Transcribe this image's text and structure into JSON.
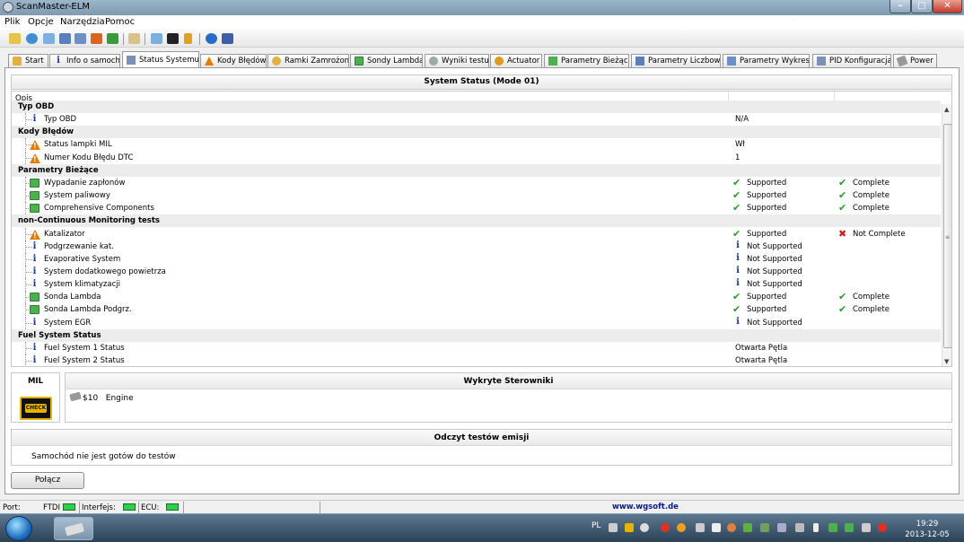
{
  "window": {
    "title": "ScanMaster-ELM"
  },
  "menu": [
    "Plik",
    "Opcje",
    "Narzędzia",
    "Pomoc"
  ],
  "tabs": [
    "Start",
    "Info o samoch.",
    "Status Systemu",
    "Kody Błędów",
    "Ramki Zamrożone",
    "Sondy Lambda",
    "Wyniki testu",
    "Actuator",
    "Parametry Bieżące",
    "Parametry Liczbowe",
    "Parametry Wykresy",
    "PID Konfiguracja",
    "Power"
  ],
  "active_tab": "Status Systemu",
  "system_status": {
    "title": "System Status (Mode 01)",
    "column_header": "Opis",
    "groups": [
      {
        "label": "Typ OBD",
        "rows": [
          {
            "icon": "info-icon",
            "label": "Typ OBD",
            "value": "N/A"
          }
        ]
      },
      {
        "label": "Kody Błędów",
        "rows": [
          {
            "icon": "warning-icon",
            "label": "Status lampki MIL",
            "value": "Wł"
          },
          {
            "icon": "warning-icon",
            "label": "Numer Kodu Błędu DTC",
            "value": "1"
          }
        ]
      },
      {
        "label": "Parametry Bieżące",
        "rows": [
          {
            "icon": "green-monitor-icon",
            "label": "Wypadanie zapłonów",
            "status1_icon": "check-icon",
            "status1": "Supported",
            "status2_icon": "check-icon",
            "status2": "Complete"
          },
          {
            "icon": "green-monitor-icon",
            "label": "System paliwowy",
            "status1_icon": "check-icon",
            "status1": "Supported",
            "status2_icon": "check-icon",
            "status2": "Complete"
          },
          {
            "icon": "green-monitor-icon",
            "label": "Comprehensive Components",
            "status1_icon": "check-icon",
            "status1": "Supported",
            "status2_icon": "check-icon",
            "status2": "Complete"
          }
        ]
      },
      {
        "label": "non-Continuous Monitoring tests",
        "rows": [
          {
            "icon": "warning-icon",
            "label": "Katalizator",
            "status1_icon": "check-icon",
            "status1": "Supported",
            "status2_icon": "cross-icon",
            "status2": "Not Complete"
          },
          {
            "icon": "info-icon",
            "label": "Podgrzewanie kat.",
            "status1_icon": "info-icon",
            "status1": "Not Supported"
          },
          {
            "icon": "info-icon",
            "label": "Evaporative System",
            "status1_icon": "info-icon",
            "status1": "Not Supported"
          },
          {
            "icon": "info-icon",
            "label": "System dodatkowego powietrza",
            "status1_icon": "info-icon",
            "status1": "Not Supported"
          },
          {
            "icon": "info-icon",
            "label": "System klimatyzacji",
            "status1_icon": "info-icon",
            "status1": "Not Supported"
          },
          {
            "icon": "green-monitor-icon",
            "label": "Sonda Lambda",
            "status1_icon": "check-icon",
            "status1": "Supported",
            "status2_icon": "check-icon",
            "status2": "Complete"
          },
          {
            "icon": "green-monitor-icon",
            "label": "Sonda Lambda Podgrz.",
            "status1_icon": "check-icon",
            "status1": "Supported",
            "status2_icon": "check-icon",
            "status2": "Complete"
          },
          {
            "icon": "info-icon",
            "label": "System EGR",
            "status1_icon": "info-icon",
            "status1": "Not Supported"
          }
        ]
      },
      {
        "label": "Fuel System Status",
        "rows": [
          {
            "icon": "info-icon",
            "label": "Fuel System 1 Status",
            "value": "Otwarta Pętla"
          },
          {
            "icon": "info-icon",
            "label": "Fuel System 2 Status",
            "value": "Otwarta Pętla"
          }
        ]
      }
    ]
  },
  "mil": {
    "title": "MIL",
    "lamp_text": "CHECK"
  },
  "ecus": {
    "title": "Wykryte Sterowniki",
    "items": [
      {
        "id": "$10",
        "name": "Engine"
      }
    ]
  },
  "emissions": {
    "title": "Odczyt testów emisji",
    "text": "Samochód nie jest gotów do testów"
  },
  "connect_button": "Połącz",
  "statusbar": {
    "port_label": "Port:",
    "port_value": "FTDI",
    "interface_label": "Interfejs:",
    "ecu_label": "ECU:",
    "url": "www.wgsoft.de",
    "led_color": "#2ed04a"
  },
  "taskbar": {
    "lang": "PL",
    "time": "19:29",
    "date": "2013-12-05"
  }
}
